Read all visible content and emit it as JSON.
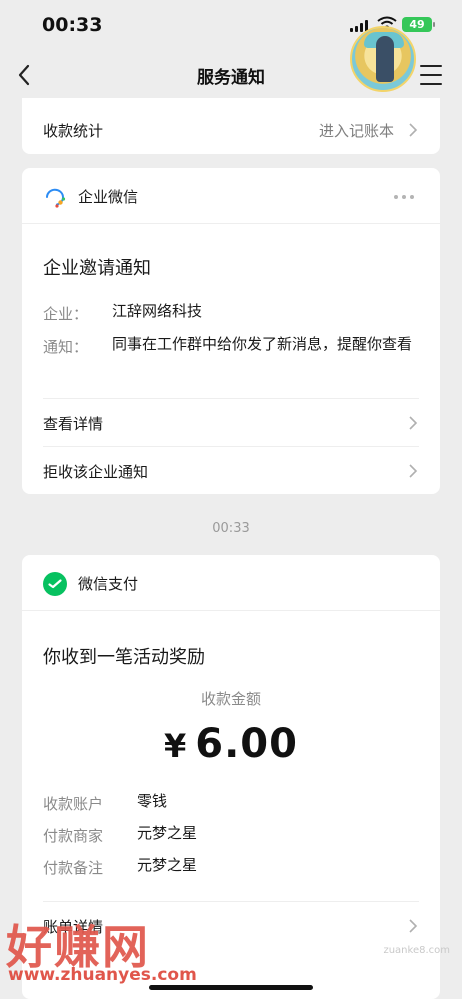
{
  "status_bar": {
    "time": "00:33",
    "battery": "49"
  },
  "nav": {
    "title": "服务通知"
  },
  "stats_row": {
    "label": "收款统计",
    "action": "进入记账本"
  },
  "wecom_card": {
    "brand": "企业微信",
    "title": "企业邀请通知",
    "fields": [
      {
        "key": "企业：",
        "value": "江辞网络科技"
      },
      {
        "key": "通知：",
        "value": "同事在工作群中给你发了新消息，提醒你查看"
      }
    ],
    "actions": [
      "查看详情",
      "拒收该企业通知"
    ]
  },
  "timestamp": "00:33",
  "pay_card": {
    "brand": "微信支付",
    "title": "你收到一笔活动奖励",
    "amount_label": "收款金额",
    "currency": "¥",
    "amount": "6.00",
    "fields": [
      {
        "key": "收款账户",
        "value": "零钱"
      },
      {
        "key": "付款商家",
        "value": "元梦之星"
      },
      {
        "key": "付款备注",
        "value": "元梦之星"
      }
    ],
    "details_action": "账单详情"
  },
  "watermark": {
    "main": "好赚网",
    "sub": "www.zhuanyes.com",
    "small": "zuanke8.com"
  },
  "colors": {
    "background": "#ededed",
    "wechat_pay_green": "#07c160",
    "watermark_red": "#e0564b"
  },
  "icons": [
    "signal-icon",
    "wifi-icon",
    "battery-icon",
    "back-icon",
    "menu-icon",
    "wecom-icon",
    "more-icon",
    "wechat-pay-icon",
    "chevron-right-icon"
  ]
}
